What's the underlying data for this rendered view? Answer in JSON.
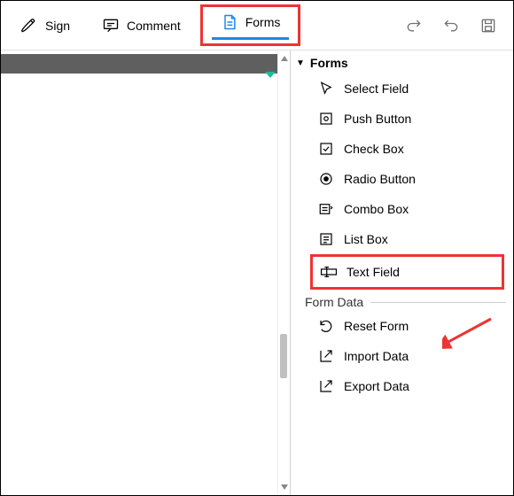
{
  "toolbar": {
    "sign_label": "Sign",
    "comment_label": "Comment",
    "forms_label": "Forms"
  },
  "panel": {
    "header": "Forms",
    "items": {
      "select_field": "Select Field",
      "push_button": "Push Button",
      "check_box": "Check Box",
      "radio_button": "Radio Button",
      "combo_box": "Combo Box",
      "list_box": "List Box",
      "text_field": "Text Field"
    },
    "form_data_header": "Form Data",
    "data_items": {
      "reset_form": "Reset Form",
      "import_data": "Import Data",
      "export_data": "Export Data"
    }
  },
  "colors": {
    "highlight": "#e33",
    "accent": "#1e88e5"
  }
}
